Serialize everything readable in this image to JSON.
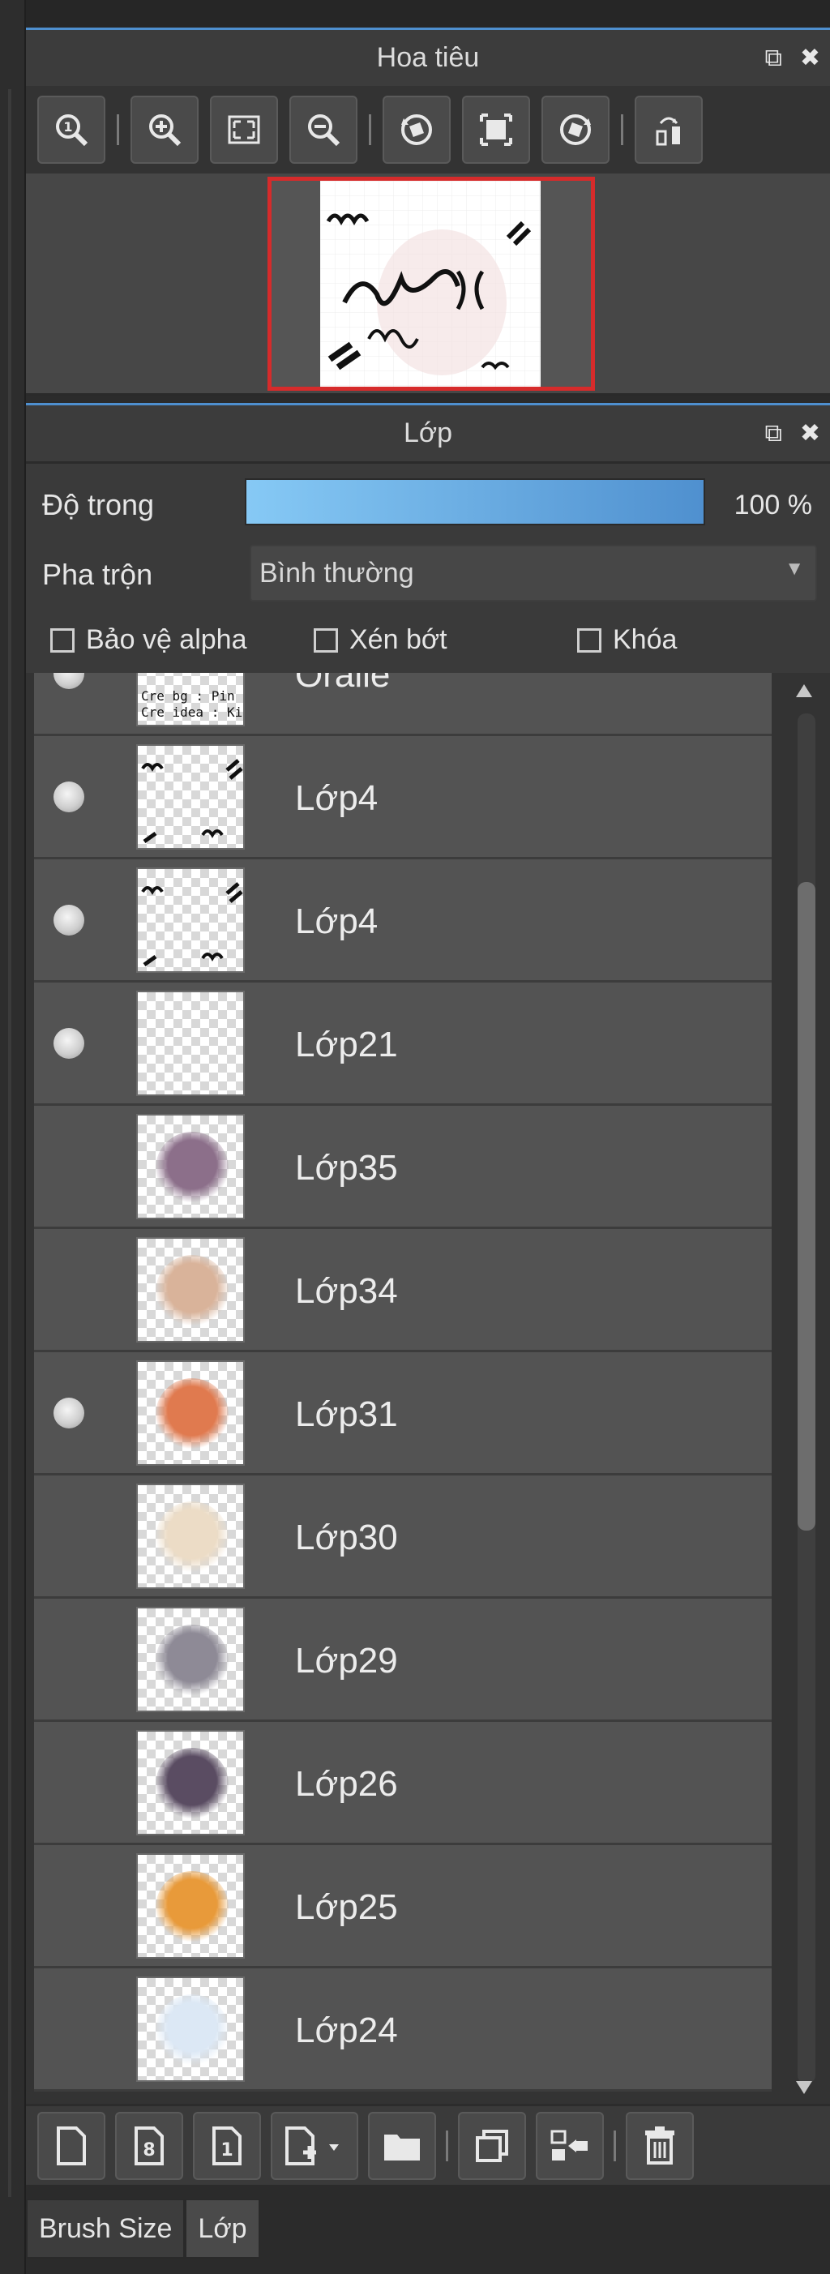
{
  "navigator": {
    "title": "Hoa tiêu",
    "popout_icon": "popout-icon",
    "close_icon": "close-icon",
    "toolbar": [
      {
        "name": "zoom-actual-icon"
      },
      {
        "name": "zoom-in-icon"
      },
      {
        "name": "fit-screen-icon"
      },
      {
        "name": "zoom-out-icon"
      },
      {
        "name": "rotate-left-icon"
      },
      {
        "name": "reset-view-icon"
      },
      {
        "name": "rotate-right-icon"
      },
      {
        "name": "flip-horizontal-icon"
      }
    ]
  },
  "layers": {
    "title": "Lớp",
    "opacity_label": "Độ trong",
    "opacity_value": "100 %",
    "opacity_fraction": 1.0,
    "blend_label": "Pha trộn",
    "blend_value": "Bình thường",
    "protect_alpha_label": "Bảo vệ alpha",
    "clipping_label": "Xén bớt",
    "lock_label": "Khóa",
    "items": [
      {
        "name": "Oralle",
        "visible": true,
        "thumb": "text"
      },
      {
        "name": "Lớp4",
        "visible": true,
        "thumb": "squiggle"
      },
      {
        "name": "Lớp4",
        "visible": true,
        "thumb": "squiggle"
      },
      {
        "name": "Lớp21",
        "visible": true,
        "thumb": "empty"
      },
      {
        "name": "Lớp35",
        "visible": false,
        "thumb": "#8c6f8a"
      },
      {
        "name": "Lớp34",
        "visible": false,
        "thumb": "#d9b39a"
      },
      {
        "name": "Lớp31",
        "visible": true,
        "thumb": "#e07a4f"
      },
      {
        "name": "Lớp30",
        "visible": false,
        "thumb": "#ecdcc6"
      },
      {
        "name": "Lớp29",
        "visible": false,
        "thumb": "#8e8a96"
      },
      {
        "name": "Lớp26",
        "visible": false,
        "thumb": "#5a4c62"
      },
      {
        "name": "Lớp25",
        "visible": false,
        "thumb": "#e89a3a"
      },
      {
        "name": "Lớp24",
        "visible": false,
        "thumb": "#dce8f5"
      }
    ],
    "bottom_toolbar": [
      "new-layer-icon",
      "new-8bit-layer-icon",
      "new-1bit-layer-icon",
      "add-layer-menu-icon",
      "new-folder-icon",
      "duplicate-layer-icon",
      "merge-down-icon",
      "delete-layer-icon"
    ]
  },
  "tabs": [
    {
      "label": "Brush Size",
      "active": false
    },
    {
      "label": "Lớp",
      "active": true
    }
  ]
}
